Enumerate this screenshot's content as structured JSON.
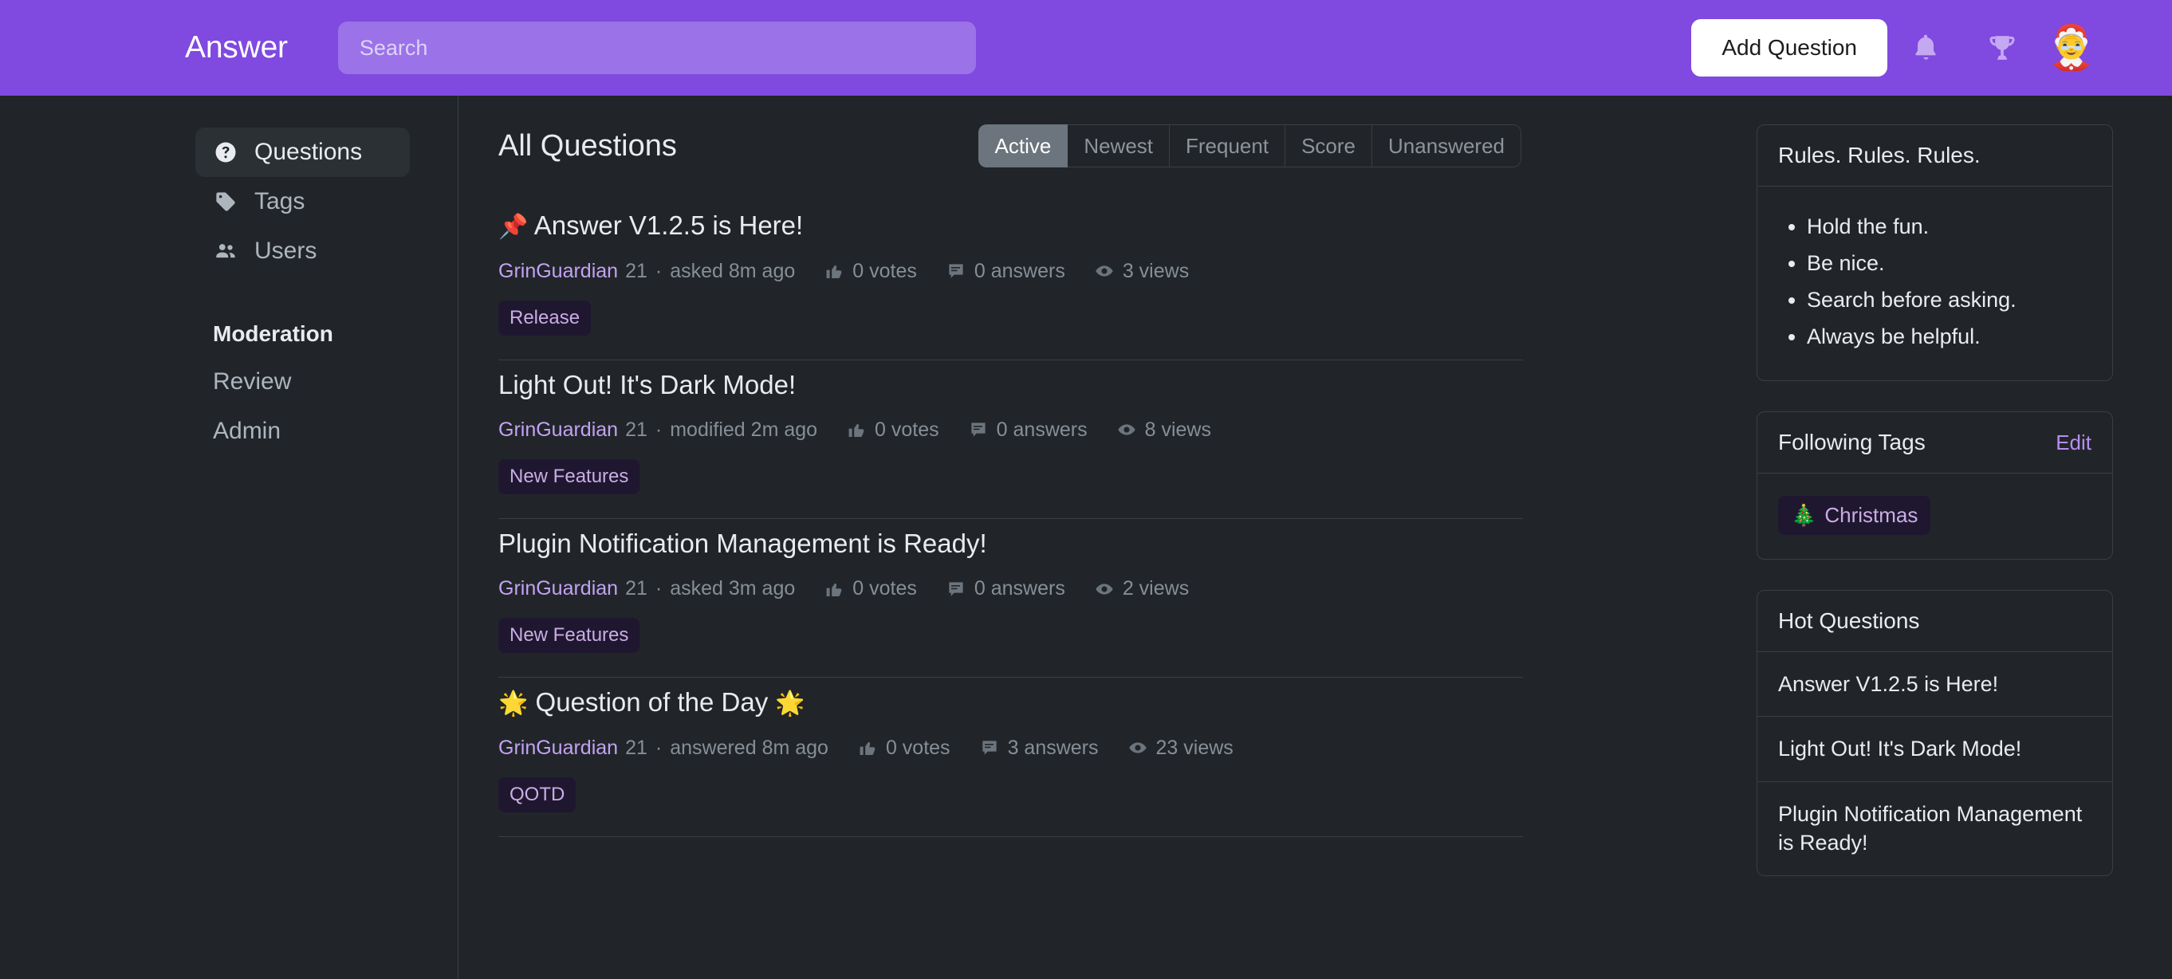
{
  "header": {
    "brand": "Answer",
    "search_placeholder": "Search",
    "search_value": "",
    "add_question_label": "Add Question",
    "notifications_icon": "bell-icon",
    "achievements_icon": "trophy-icon",
    "avatar_emoji": "🤶",
    "bg_color": "#8049e0",
    "search_bg_color": "#9b72e8"
  },
  "sidebar": {
    "items": [
      {
        "label": "Questions",
        "icon": "question-circle-icon",
        "active": true
      },
      {
        "label": "Tags",
        "icon": "tag-icon",
        "active": false
      },
      {
        "label": "Users",
        "icon": "users-icon",
        "active": false
      }
    ],
    "section_heading": "Moderation",
    "sub_items": [
      {
        "label": "Review"
      },
      {
        "label": "Admin"
      }
    ]
  },
  "main": {
    "title": "All Questions",
    "tabs": [
      {
        "label": "Active",
        "active": true
      },
      {
        "label": "Newest",
        "active": false
      },
      {
        "label": "Frequent",
        "active": false
      },
      {
        "label": "Score",
        "active": false
      },
      {
        "label": "Unanswered",
        "active": false
      }
    ],
    "questions": [
      {
        "prefix_emoji": "📌",
        "title": "Answer V1.2.5 is Here!",
        "suffix_emoji": "",
        "user": "GrinGuardian",
        "reputation": "21",
        "activity": "asked 8m ago",
        "votes": "0 votes",
        "answers": "0 answers",
        "views": "3 views",
        "tags": [
          "Release"
        ]
      },
      {
        "prefix_emoji": "",
        "title": "Light Out! It's Dark Mode!",
        "suffix_emoji": "",
        "user": "GrinGuardian",
        "reputation": "21",
        "activity": "modified 2m ago",
        "votes": "0 votes",
        "answers": "0 answers",
        "views": "8 views",
        "tags": [
          "New Features"
        ]
      },
      {
        "prefix_emoji": "",
        "title": "Plugin Notification Management is Ready!",
        "suffix_emoji": "",
        "user": "GrinGuardian",
        "reputation": "21",
        "activity": "asked 3m ago",
        "votes": "0 votes",
        "answers": "0 answers",
        "views": "2 views",
        "tags": [
          "New Features"
        ]
      },
      {
        "prefix_emoji": "🌟",
        "title": "Question of the Day",
        "suffix_emoji": "🌟",
        "user": "GrinGuardian",
        "reputation": "21",
        "activity": "answered 8m ago",
        "votes": "0 votes",
        "answers": "3 answers",
        "views": "23 views",
        "tags": [
          "QOTD"
        ]
      }
    ]
  },
  "rightbar": {
    "rules_card": {
      "title": "Rules. Rules. Rules.",
      "items": [
        "Hold the fun.",
        "Be nice.",
        "Search before asking.",
        "Always be helpful."
      ]
    },
    "following_tags_card": {
      "title": "Following Tags",
      "edit_label": "Edit",
      "tags": [
        {
          "emoji": "🎄",
          "label": "Christmas"
        }
      ]
    },
    "hot_questions_card": {
      "title": "Hot Questions",
      "items": [
        "Answer V1.2.5 is Here!",
        "Light Out! It's Dark Mode!",
        "Plugin Notification Management is Ready!"
      ]
    }
  },
  "colors": {
    "page_bg": "#212529",
    "border": "#3a3f44",
    "accent_purple": "#8049e0",
    "link_purple": "#c4a2f5",
    "tag_bg": "#1f1730",
    "tag_text": "#c9ade3",
    "muted_text": "#868e96",
    "body_text": "#e9ecef"
  }
}
